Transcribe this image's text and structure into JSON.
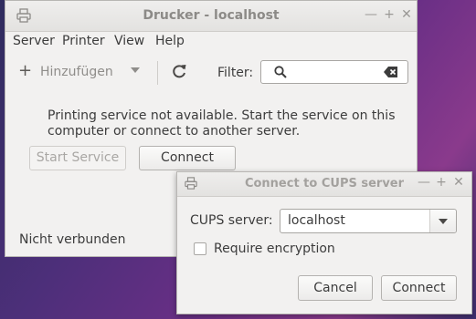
{
  "main_window": {
    "title": "Drucker - localhost",
    "menu": [
      "Server",
      "Printer",
      "View",
      "Help"
    ],
    "toolbar": {
      "add_label": "Hinzufügen",
      "filter_label": "Filter:",
      "filter_value": ""
    },
    "message": "Printing service not available.  Start the service on this computer or connect to another server.",
    "start_service_label": "Start Service",
    "connect_label": "Connect",
    "status": "Nicht verbunden"
  },
  "dialog": {
    "title": "Connect to CUPS server",
    "server_label": "CUPS server:",
    "server_value": "localhost",
    "encryption_label": "Require encryption",
    "encryption_checked": false,
    "cancel_label": "Cancel",
    "connect_label": "Connect"
  },
  "icons": {
    "window": "printer-icon",
    "add": "plus-icon",
    "refresh": "refresh-icon",
    "search": "search-icon",
    "clear": "clear-icon"
  }
}
